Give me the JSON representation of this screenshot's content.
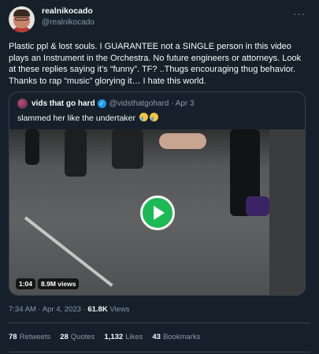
{
  "author": {
    "display_name": "realnikocado",
    "handle": "@realnikocado",
    "more_label": "···"
  },
  "tweet": {
    "text": "Plastic ppl & lost souls. I GUARANTEE not a SINGLE person in this video plays an Instrument in the Orchestra. No future engineers or attorneys. Look at these replies saying it’s “funny”. TF? ..Thugs encouraging thug behavior. Thanks to rap “music” glorying it… I hate this world."
  },
  "quote": {
    "display_name": "vids that go hard",
    "verified_icon": "verified-badge-icon",
    "handle_date": "@vidsthatgohard · Apr 3",
    "text": "slammed her like the undertaker",
    "emoji": "loudly-crying-face-icon x2",
    "video": {
      "duration": "1:04",
      "views": "8.9M views",
      "play_color": "#1db954"
    }
  },
  "meta": {
    "timestamp": "7:34 AM · Apr 4, 2023 · ",
    "views_count": "61.8K",
    "views_label": " Views"
  },
  "stats": [
    {
      "count": "78",
      "label": "Retweets"
    },
    {
      "count": "28",
      "label": "Quotes"
    },
    {
      "count": "1,132",
      "label": "Likes"
    },
    {
      "count": "43",
      "label": "Bookmarks"
    }
  ],
  "colors": {
    "background": "#15202b",
    "border": "#38444d",
    "secondary_text": "#8b98a5",
    "verified": "#1d9bf0"
  }
}
